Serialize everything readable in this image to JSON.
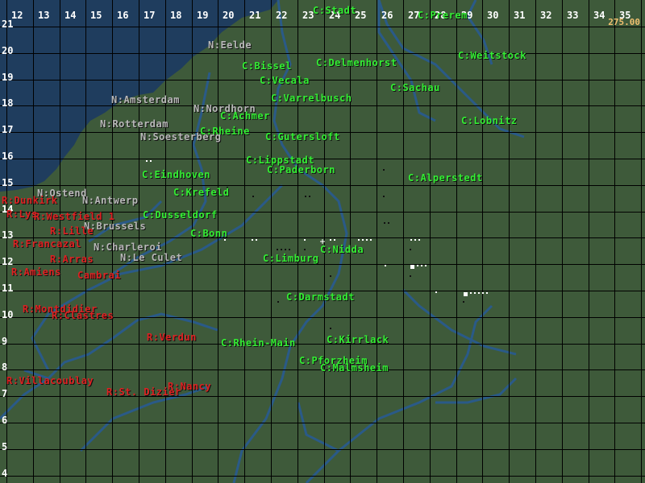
{
  "clock": "275.00",
  "grid": {
    "columns": [
      "12",
      "13",
      "14",
      "15",
      "16",
      "17",
      "18",
      "19",
      "20",
      "21",
      "22",
      "23",
      "24",
      "25",
      "26",
      "27",
      "28",
      "29",
      "30",
      "31",
      "32",
      "33",
      "34",
      "35"
    ],
    "rows": [
      "21",
      "20",
      "19",
      "18",
      "17",
      "16",
      "15",
      "14",
      "13",
      "12",
      "11",
      "10",
      "9",
      "8",
      "7",
      "6",
      "5",
      "4"
    ]
  },
  "labels": {
    "c_stadt": "C:Stadt",
    "c_prerem": "C:Prerem",
    "n_eelde": "N:Eelde",
    "c_bissel": "C:Bissel",
    "c_delmenhorst": "C:Delmenhorst",
    "c_weitstock": "C:Weitstock",
    "c_vecala": "C:Vecala",
    "c_sachau": "C:Sachau",
    "n_amsterdam": "N:Amsterdam",
    "c_varrelbusch": "C:Varrelbusch",
    "n_nordhorn": "N:Nordhorn",
    "c_achmer": "C:Achmer",
    "c_lobnitz": "C:Lobnitz",
    "n_rotterdam": "N:Rotterdam",
    "c_rheine": "C:Rheine",
    "n_soesterberg": "N:Soesterberg",
    "c_gutersloft": "C:Gutersloft",
    "c_lippstadt": "C:Lippstadt",
    "c_paderborn": "C:Paderborn",
    "c_eindhoven": "C:Eindhoven",
    "c_alperstedt": "C:Alperstedt",
    "n_ostend": "N:Ostend",
    "c_krefeld": "C:Krefeld",
    "n_antwerp": "N:Antwerp",
    "r_dunkirk": "R:Dunkirk",
    "r_laplace": "R:Lys",
    "r_westfield": "R:Westfield 1",
    "c_dusseldorf": "C:Dusseldorf",
    "n_brussels": "N:Brussels",
    "r_lille": "R:Lille",
    "c_bonn": "C:Bonn",
    "r_francazal": "R:Francazal",
    "n_charleroi": "N:Charleroi",
    "c_nidda": "C:Nidda",
    "r_arras": "R:Arras",
    "n_le_culet": "N:Le Culet",
    "c_limburg": "C:Limburg",
    "r_amiens": "R:Amiens",
    "r_cambrai": "Cambrai",
    "c_darmstadt": "C:Darmstadt",
    "r_montdidier": "R:Montdidier",
    "r_clastres": "R:Clastres",
    "r_verdun": "R:Verdun",
    "c_rhein_main": "C:Rhein-Main",
    "c_kirrlack": "C:Kirrlack",
    "c_pforzheim": "C:Pforzheim",
    "c_malmsheim": "C:Malmsheim",
    "r_villacoublay": "R:Villacoublay",
    "r_nancy": "R:Nancy",
    "r_st_dizier": "R:St. Dizier"
  },
  "colors": {
    "land": "#3e5a3a",
    "sea": "#1f3d5e",
    "river": "#2a5a88",
    "grid": "#000000",
    "c_side": "#33ee33",
    "n_side": "#b8b8b8",
    "r_side": "#dd2222",
    "clock": "#f0c070"
  }
}
